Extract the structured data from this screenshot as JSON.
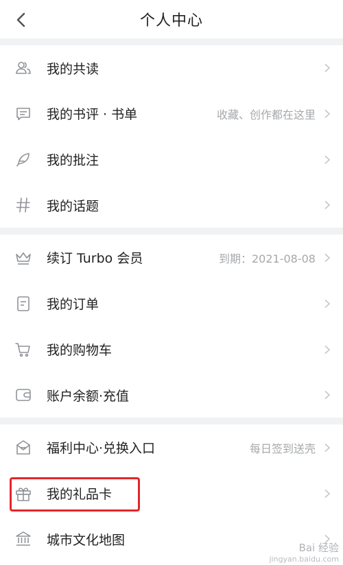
{
  "header": {
    "title": "个人中心"
  },
  "section1": [
    {
      "label": "我的共读",
      "hint": ""
    },
    {
      "label": "我的书评 · 书单",
      "hint": "收藏、创作都在这里"
    },
    {
      "label": "我的批注",
      "hint": ""
    },
    {
      "label": "我的话题",
      "hint": ""
    }
  ],
  "section2": [
    {
      "label": "续订 Turbo 会员",
      "hint": "到期：2021-08-08"
    },
    {
      "label": "我的订单",
      "hint": ""
    },
    {
      "label": "我的购物车",
      "hint": ""
    },
    {
      "label": "账户余额·充值",
      "hint": ""
    }
  ],
  "section3": [
    {
      "label": "福利中心·兑换入口",
      "hint": "每日签到送壳"
    },
    {
      "label": "我的礼品卡",
      "hint": ""
    },
    {
      "label": "城市文化地图",
      "hint": ""
    }
  ],
  "watermark": {
    "main": "Bai 经验",
    "sub": "jingyan.baidu.com"
  },
  "colors": {
    "highlight": "#e3262a",
    "icon": "#8f9297",
    "hint": "#a6a8ab",
    "separator": "#f1f2f4"
  },
  "icons": [
    "users-icon",
    "comment-icon",
    "feather-icon",
    "hash-icon",
    "crown-icon",
    "order-icon",
    "cart-icon",
    "wallet-icon",
    "gift-box-icon",
    "gift-icon",
    "museum-icon"
  ]
}
